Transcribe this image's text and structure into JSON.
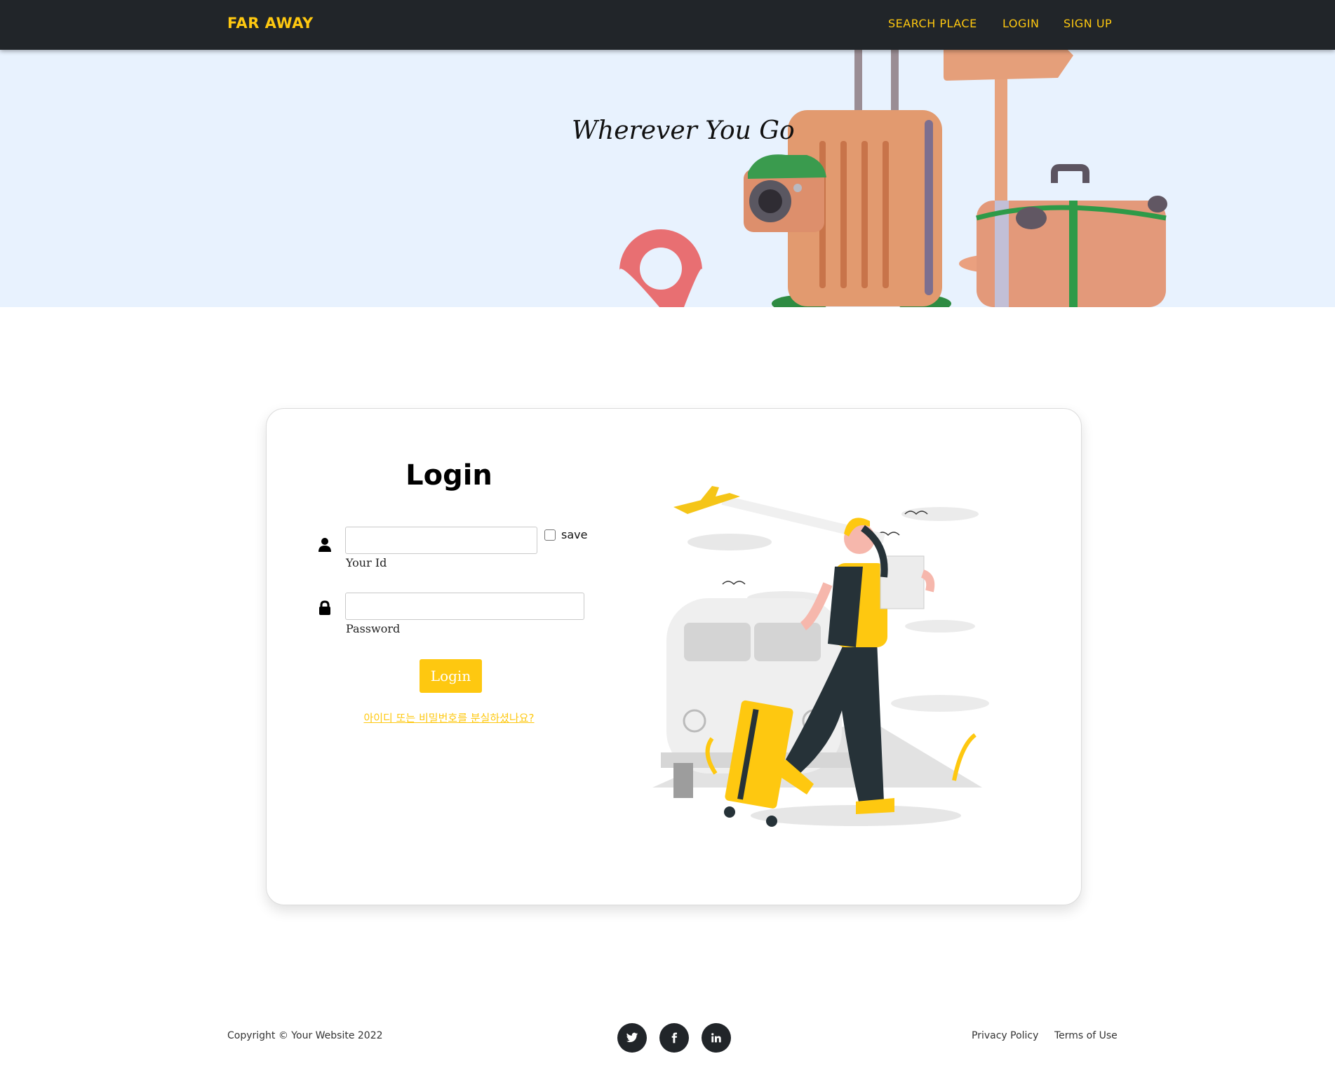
{
  "navbar": {
    "brand": "FAR AWAY",
    "links": [
      "SEARCH PLACE",
      "LOGIN",
      "SIGN UP"
    ]
  },
  "hero": {
    "tagline": "Wherever You Go"
  },
  "login": {
    "title": "Login",
    "id_field": {
      "label": "Your Id",
      "value": "",
      "placeholder": ""
    },
    "save_label": "save",
    "save_checked": false,
    "password_field": {
      "label": "Password",
      "value": "",
      "placeholder": ""
    },
    "submit_label": "Login",
    "forgot_link": "아이디 또는 비밀번호를 분실하셨나요?"
  },
  "footer": {
    "copyright": "Copyright © Your Website 2022",
    "social": [
      "twitter-icon",
      "facebook-icon",
      "linkedin-icon"
    ],
    "links": [
      "Privacy Policy",
      "Terms of Use"
    ]
  },
  "colors": {
    "accent": "#fec810",
    "navbar_bg": "#212529",
    "hero_bg": "#e8f2fe"
  }
}
